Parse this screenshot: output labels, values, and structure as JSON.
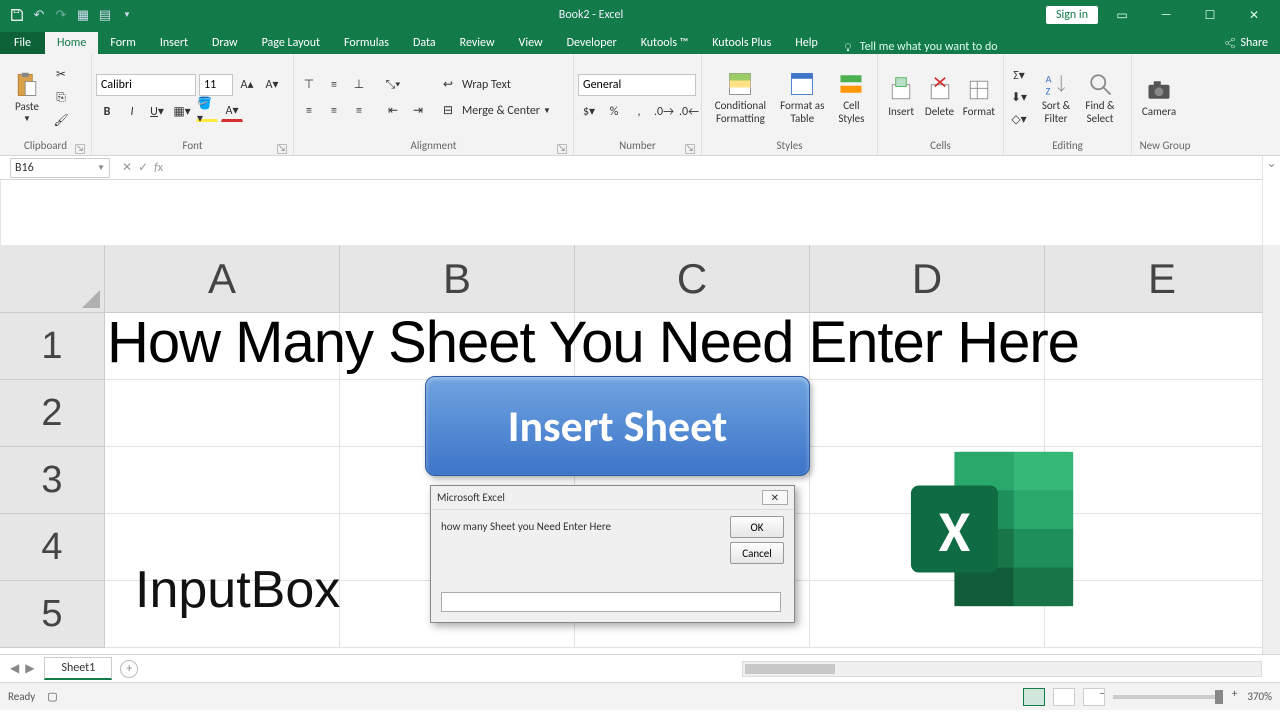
{
  "titlebar": {
    "title": "Book2 - Excel",
    "signin": "Sign in"
  },
  "tabs": {
    "file": "File",
    "list": [
      "Home",
      "Form",
      "Insert",
      "Draw",
      "Page Layout",
      "Formulas",
      "Data",
      "Review",
      "View",
      "Developer",
      "Kutools ™",
      "Kutools Plus",
      "Help"
    ],
    "active": "Home",
    "tellme": "Tell me what you want to do",
    "share": "Share"
  },
  "ribbon": {
    "clipboard": {
      "label": "Clipboard",
      "paste": "Paste"
    },
    "font": {
      "label": "Font",
      "name": "Calibri",
      "size": "11"
    },
    "alignment": {
      "label": "Alignment",
      "wrap": "Wrap Text",
      "merge": "Merge & Center"
    },
    "number": {
      "label": "Number",
      "format": "General"
    },
    "styles": {
      "label": "Styles",
      "cond": "Conditional Formatting",
      "table": "Format as Table",
      "cell": "Cell Styles"
    },
    "cells": {
      "label": "Cells",
      "insert": "Insert",
      "delete": "Delete",
      "format": "Format"
    },
    "editing": {
      "label": "Editing",
      "sort": "Sort & Filter",
      "find": "Find & Select"
    },
    "newgroup": {
      "label": "New Group",
      "camera": "Camera"
    }
  },
  "namebox": "B16",
  "columns": [
    "A",
    "B",
    "C",
    "D",
    "E"
  ],
  "rows": [
    "1",
    "2",
    "3",
    "4",
    "5"
  ],
  "sheet": {
    "a1": "How Many Sheet You Need Enter Here",
    "button": "Insert Sheet",
    "label": "InputBox"
  },
  "dialog": {
    "title": "Microsoft Excel",
    "msg": "how many Sheet you Need Enter Here",
    "ok": "OK",
    "cancel": "Cancel"
  },
  "sheetbar": {
    "tab": "Sheet1"
  },
  "status": {
    "ready": "Ready",
    "zoom": "370%"
  }
}
